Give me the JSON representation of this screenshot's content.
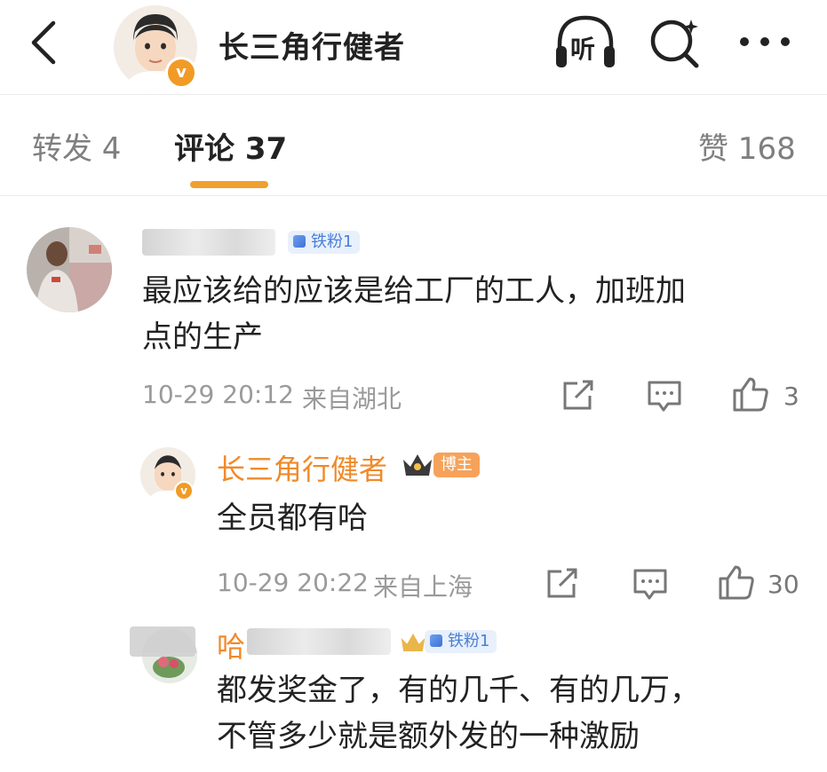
{
  "header": {
    "title": "长三角行健者",
    "listen_label": "听"
  },
  "tabs": {
    "repost": "转发 4",
    "comments": "评论 37",
    "likes": "赞 168"
  },
  "comments": [
    {
      "badge": "铁粉1",
      "text": "最应该给的应该是给工厂的工人，加班加\n点的生产",
      "time": "10-29 20:12",
      "location": "来自湖北",
      "likes": "3",
      "reply": {
        "username": "长三角行健者",
        "badge": "博主",
        "text": "全员都有哈",
        "time": "10-29 20:22",
        "location": "来自上海",
        "likes": "30"
      },
      "reply2": {
        "username_visible": "哈",
        "badge": "铁粉1",
        "text": "都发奖金了，有的几千、有的几万，\n不管多少就是额外发的一种激励"
      }
    }
  ],
  "icons": {
    "back": "chevron-left-icon",
    "listen": "headphones-icon",
    "search": "search-icon",
    "more": "more-dots-icon",
    "share": "share-icon",
    "comment": "comment-icon",
    "like": "thumb-up-icon",
    "verified": "verified-v-icon",
    "crown": "crown-icon"
  },
  "colors": {
    "accent": "#f0a02d",
    "username": "#f08a2a",
    "fan_badge_bg": "#e8f0fc",
    "fan_badge_text": "#4a7fd6",
    "owner_badge": "#f6a25a"
  },
  "verified_mark": "v"
}
